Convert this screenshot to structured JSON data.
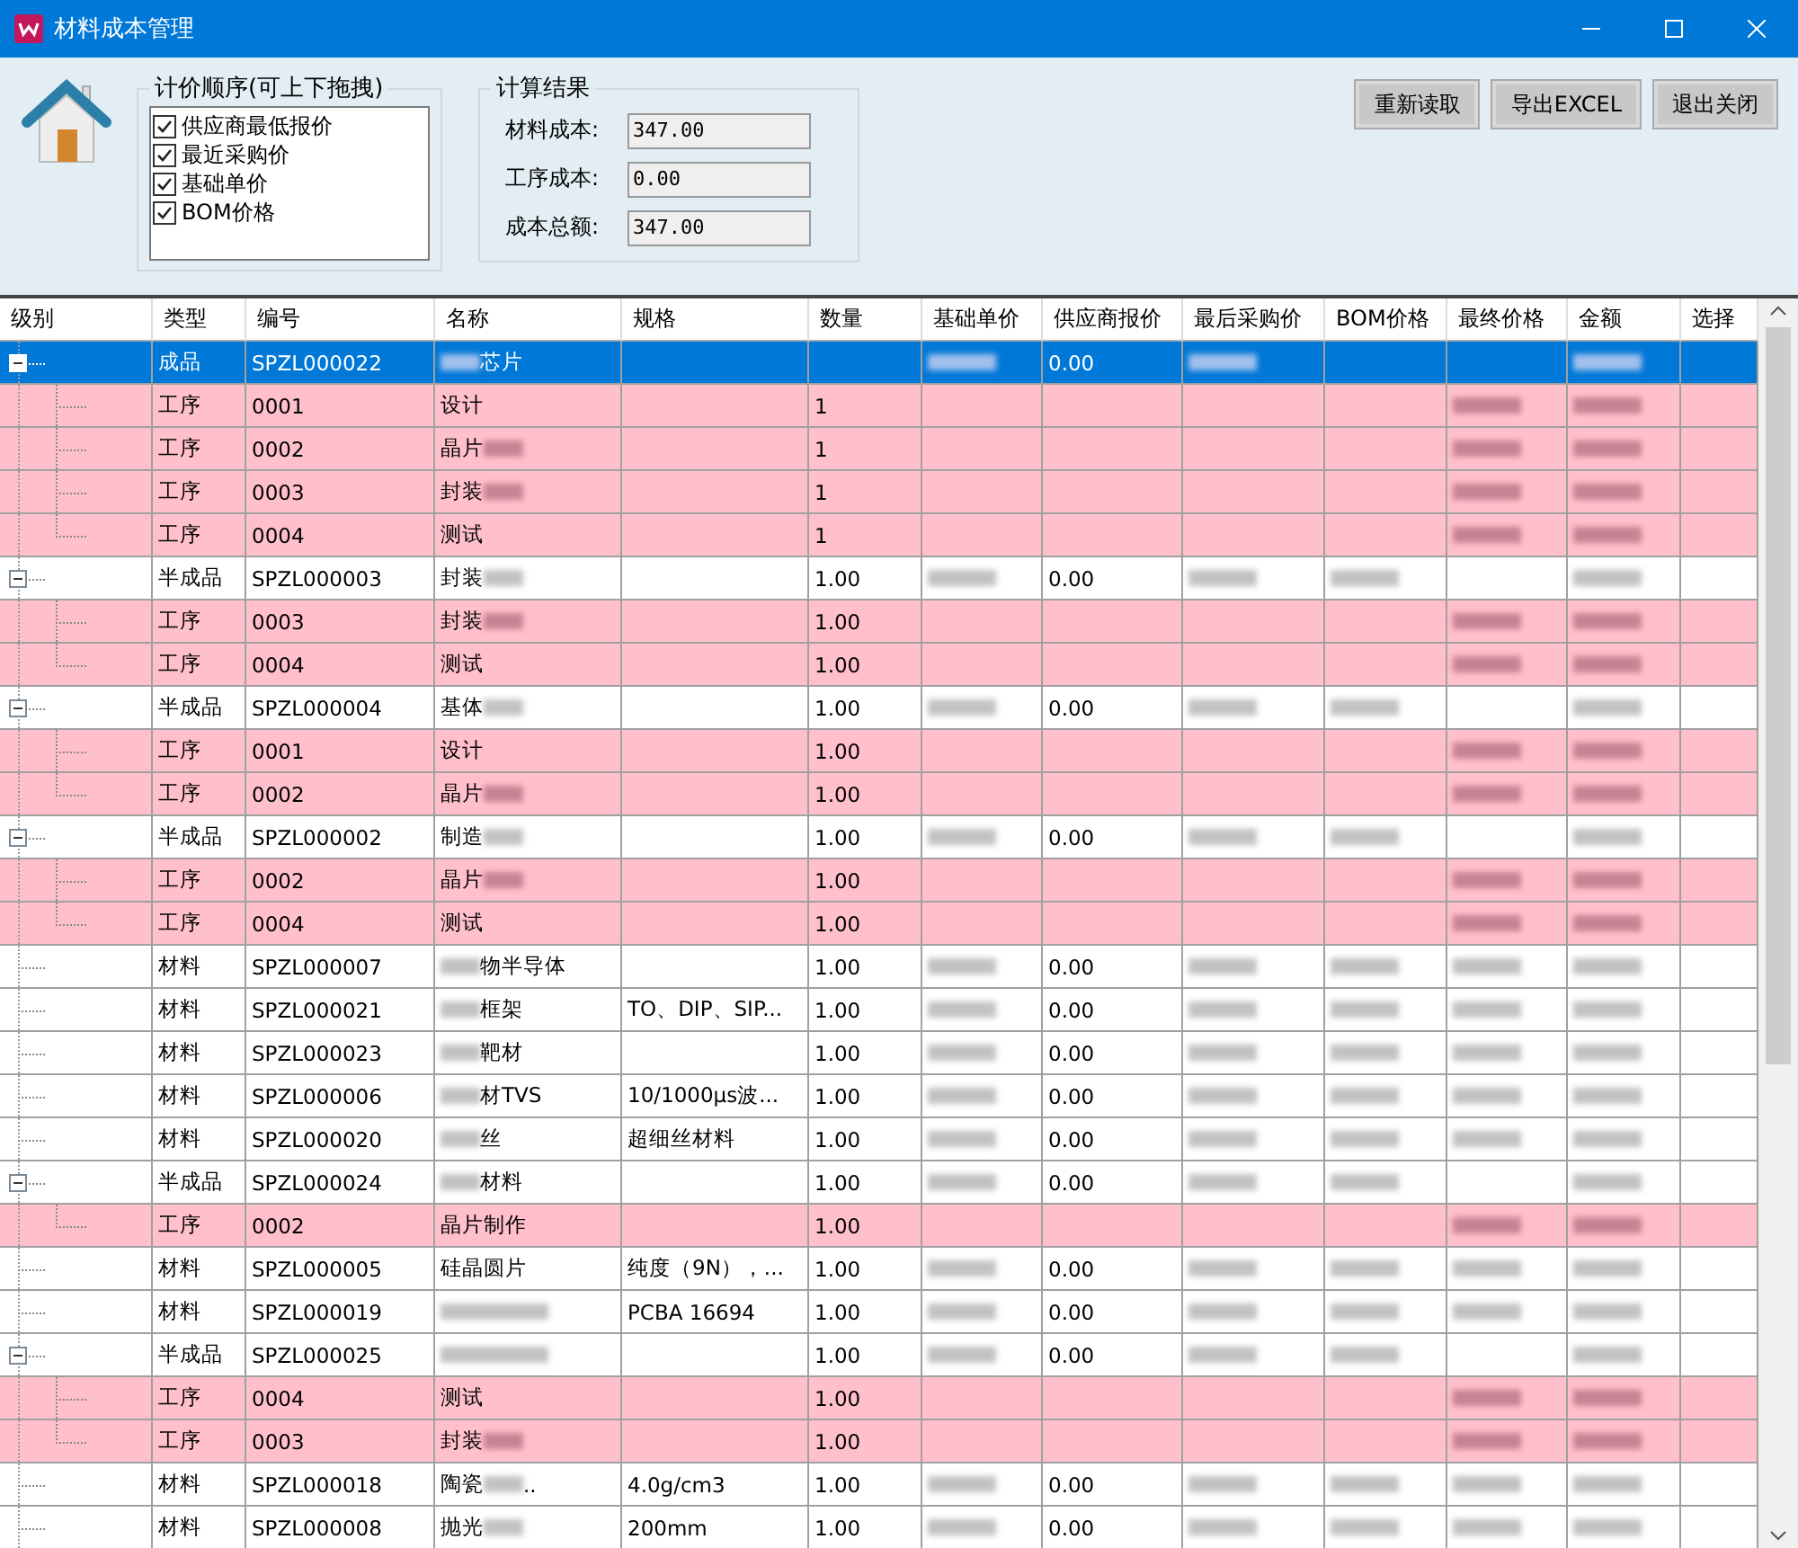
{
  "window": {
    "title": "材料成本管理"
  },
  "pricing_order": {
    "title": "计价顺序(可上下拖拽)",
    "items": [
      {
        "label": "供应商最低报价",
        "checked": true
      },
      {
        "label": "最近采购价",
        "checked": true
      },
      {
        "label": "基础单价",
        "checked": true
      },
      {
        "label": "BOM价格",
        "checked": true
      }
    ]
  },
  "results": {
    "title": "计算结果",
    "fields": [
      {
        "label": "材料成本:",
        "value": "347.00"
      },
      {
        "label": "工序成本:",
        "value": "0.00"
      },
      {
        "label": "成本总额:",
        "value": "347.00"
      }
    ]
  },
  "buttons": [
    "重新读取",
    "导出EXCEL",
    "退出关闭"
  ],
  "table": {
    "columns": [
      "级别",
      "类型",
      "编号",
      "名称",
      "规格",
      "数量",
      "基础单价",
      "供应商报价",
      "最后采购价",
      "BOM价格",
      "最终价格",
      "金额",
      "选择"
    ],
    "rows": [
      {
        "highlighted": false,
        "type": "成品",
        "code": "SPZL000022",
        "name": "芯片",
        "blur_before_name": true,
        "supplier": "0.00",
        "blurred": {
          "base": true,
          "last": true,
          "amount": true
        },
        "selected": true,
        "expanded": true,
        "children": [
          {
            "highlighted": true,
            "type": "工序",
            "code": "0001",
            "name": "设计",
            "qty": "1",
            "blurred": {
              "final": true,
              "amount": true
            },
            "selected": false
          },
          {
            "highlighted": true,
            "type": "工序",
            "code": "0002",
            "name": "晶片",
            "blur_after_name": true,
            "qty": "1",
            "blurred": {
              "final": true,
              "amount": true
            },
            "selected": false
          },
          {
            "highlighted": true,
            "type": "工序",
            "code": "0003",
            "name": "封装",
            "blur_after_name": true,
            "qty": "1",
            "blurred": {
              "final": true,
              "amount": true
            },
            "selected": false
          },
          {
            "highlighted": true,
            "type": "工序",
            "code": "0004",
            "name": "测试",
            "qty": "1",
            "blurred": {
              "final": true,
              "amount": true
            },
            "selected": false
          }
        ]
      },
      {
        "highlighted": false,
        "type": "半成品",
        "code": "SPZL000003",
        "name": "封装",
        "blur_after_name": true,
        "qty": "1.00",
        "supplier": "0.00",
        "blurred": {
          "base": true,
          "last": true,
          "bom": true,
          "amount": true
        },
        "selected": false,
        "expanded": true,
        "children": [
          {
            "highlighted": true,
            "type": "工序",
            "code": "0003",
            "name": "封装",
            "blur_after_name": true,
            "qty": "1.00",
            "blurred": {
              "final": true,
              "amount": true
            },
            "selected": false
          },
          {
            "highlighted": true,
            "type": "工序",
            "code": "0004",
            "name": "测试",
            "qty": "1.00",
            "blurred": {
              "final": true,
              "amount": true
            },
            "selected": false
          }
        ]
      },
      {
        "highlighted": false,
        "type": "半成品",
        "code": "SPZL000004",
        "name": "基体",
        "blur_after_name": true,
        "qty": "1.00",
        "supplier": "0.00",
        "blurred": {
          "base": true,
          "last": true,
          "bom": true,
          "amount": true
        },
        "selected": false,
        "expanded": true,
        "children": [
          {
            "highlighted": true,
            "type": "工序",
            "code": "0001",
            "name": "设计",
            "qty": "1.00",
            "blurred": {
              "final": true,
              "amount": true
            },
            "selected": false
          },
          {
            "highlighted": true,
            "type": "工序",
            "code": "0002",
            "name": "晶片",
            "blur_after_name": true,
            "qty": "1.00",
            "blurred": {
              "final": true,
              "amount": true
            },
            "selected": false
          }
        ]
      },
      {
        "highlighted": false,
        "type": "半成品",
        "code": "SPZL000002",
        "name": "制造",
        "blur_after_name": true,
        "qty": "1.00",
        "supplier": "0.00",
        "blurred": {
          "base": true,
          "last": true,
          "bom": true,
          "amount": true
        },
        "selected": false,
        "expanded": true,
        "children": [
          {
            "highlighted": true,
            "type": "工序",
            "code": "0002",
            "name": "晶片",
            "blur_after_name": true,
            "qty": "1.00",
            "blurred": {
              "final": true,
              "amount": true
            },
            "selected": false
          },
          {
            "highlighted": true,
            "type": "工序",
            "code": "0004",
            "name": "测试",
            "qty": "1.00",
            "blurred": {
              "final": true,
              "amount": true
            },
            "selected": false
          }
        ]
      },
      {
        "highlighted": false,
        "type": "材料",
        "code": "SPZL000007",
        "name": "物半导体",
        "blur_before_name": true,
        "qty": "1.00",
        "supplier": "0.00",
        "blurred": {
          "base": true,
          "last": true,
          "bom": true,
          "final": true,
          "amount": true
        },
        "selected": false
      },
      {
        "highlighted": false,
        "type": "材料",
        "code": "SPZL000021",
        "name": "框架",
        "blur_before_name": true,
        "spec": "TO、DIP、SIP...",
        "qty": "1.00",
        "supplier": "0.00",
        "blurred": {
          "base": true,
          "last": true,
          "bom": true,
          "final": true,
          "amount": true
        },
        "selected": false
      },
      {
        "highlighted": false,
        "type": "材料",
        "code": "SPZL000023",
        "name": "靶材",
        "blur_before_name": true,
        "qty": "1.00",
        "supplier": "0.00",
        "blurred": {
          "base": true,
          "last": true,
          "bom": true,
          "final": true,
          "amount": true
        },
        "selected": false
      },
      {
        "highlighted": false,
        "type": "材料",
        "code": "SPZL000006",
        "name": "材TVS",
        "blur_before_name": true,
        "spec": "10/1000μs波...",
        "qty": "1.00",
        "supplier": "0.00",
        "blurred": {
          "base": true,
          "last": true,
          "bom": true,
          "final": true,
          "amount": true
        },
        "selected": false
      },
      {
        "highlighted": false,
        "type": "材料",
        "code": "SPZL000020",
        "name": "丝",
        "blur_before_name": true,
        "spec": "超细丝材料",
        "qty": "1.00",
        "supplier": "0.00",
        "blurred": {
          "base": true,
          "last": true,
          "bom": true,
          "final": true,
          "amount": true
        },
        "selected": false
      },
      {
        "highlighted": false,
        "type": "半成品",
        "code": "SPZL000024",
        "name": "材料",
        "blur_before_name": true,
        "qty": "1.00",
        "supplier": "0.00",
        "blurred": {
          "base": true,
          "last": true,
          "bom": true,
          "amount": true
        },
        "selected": false,
        "expanded": true,
        "children": [
          {
            "highlighted": true,
            "type": "工序",
            "code": "0002",
            "name": "晶片制作",
            "qty": "1.00",
            "blurred": {
              "final": true,
              "amount": true
            },
            "selected": false
          }
        ]
      },
      {
        "highlighted": false,
        "type": "材料",
        "code": "SPZL000005",
        "name": "硅晶圆片",
        "spec": "纯度（9N），...",
        "qty": "1.00",
        "supplier": "0.00",
        "blurred": {
          "base": true,
          "last": true,
          "bom": true,
          "final": true,
          "amount": true
        },
        "selected": false
      },
      {
        "highlighted": false,
        "type": "材料",
        "code": "SPZL000019",
        "name_blurred": true,
        "spec": "PCBA 16694",
        "qty": "1.00",
        "supplier": "0.00",
        "blurred": {
          "base": true,
          "last": true,
          "bom": true,
          "final": true,
          "amount": true
        },
        "selected": false
      },
      {
        "highlighted": false,
        "type": "半成品",
        "code": "SPZL000025",
        "name_blurred": true,
        "qty": "1.00",
        "supplier": "0.00",
        "blurred": {
          "base": true,
          "last": true,
          "bom": true,
          "amount": true
        },
        "selected": false,
        "expanded": true,
        "children": [
          {
            "highlighted": true,
            "type": "工序",
            "code": "0004",
            "name": "测试",
            "qty": "1.00",
            "blurred": {
              "final": true,
              "amount": true
            },
            "selected": false
          },
          {
            "highlighted": true,
            "type": "工序",
            "code": "0003",
            "name": "封装",
            "blur_after_name": true,
            "qty": "1.00",
            "blurred": {
              "final": true,
              "amount": true
            },
            "selected": false
          }
        ]
      },
      {
        "highlighted": false,
        "type": "材料",
        "code": "SPZL000018",
        "name": "陶瓷",
        "blur_after_name": true,
        "name_tail": "..",
        "spec": "4.0g/cm3",
        "qty": "1.00",
        "supplier": "0.00",
        "blurred": {
          "base": true,
          "last": true,
          "bom": true,
          "final": true,
          "amount": true
        },
        "selected": false
      },
      {
        "highlighted": false,
        "type": "材料",
        "code": "SPZL000008",
        "name": "抛光",
        "blur_after_name": true,
        "spec": "200mm",
        "qty": "1.00",
        "supplier": "0.00",
        "blurred": {
          "base": true,
          "last": true,
          "bom": true,
          "final": true,
          "amount": true
        },
        "selected": false
      }
    ]
  }
}
